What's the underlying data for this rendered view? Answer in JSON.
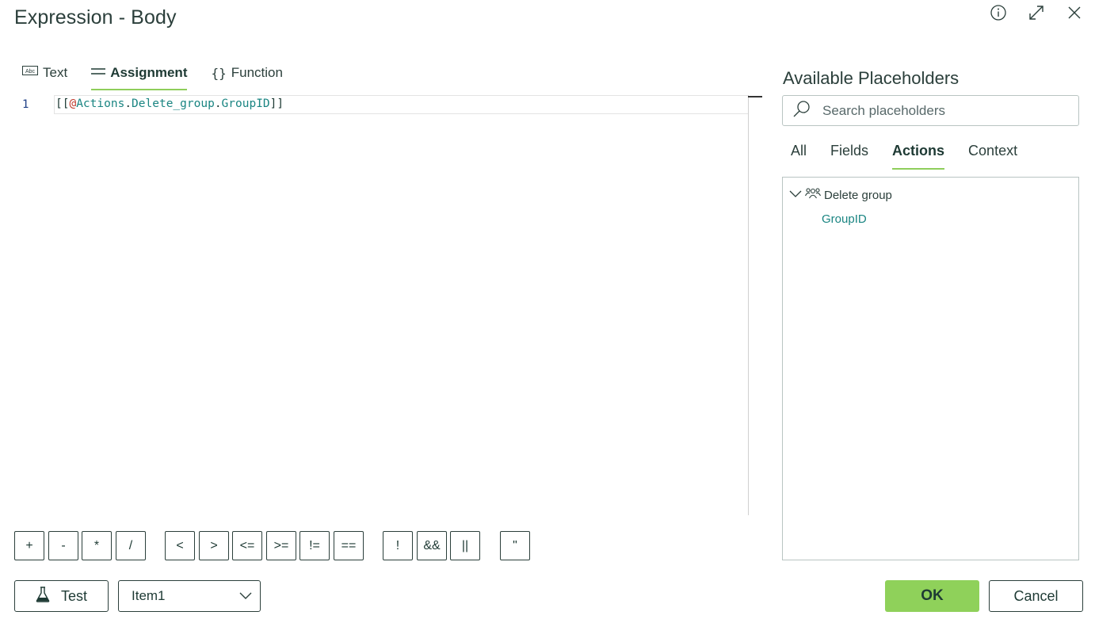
{
  "dialog": {
    "title": "Expression - Body",
    "window_icons": [
      "info-icon",
      "expand-icon",
      "close-icon"
    ]
  },
  "mode_tabs": [
    {
      "label": "Text",
      "icon": "text-abc-icon",
      "active": false
    },
    {
      "label": "Assignment",
      "icon": "assignment-lines-icon",
      "active": true
    },
    {
      "label": "Function",
      "icon": "braces-icon",
      "active": false
    }
  ],
  "editor": {
    "line_number": "1",
    "code_tokens": {
      "open": "[[",
      "at": "@",
      "part1": "Actions",
      "dot1": ".",
      "part2": "Delete_group",
      "dot2": ".",
      "part3": "GroupID",
      "close": "]]"
    }
  },
  "operators": [
    "+",
    "-",
    "*",
    "/",
    "<",
    ">",
    "<=",
    ">=",
    "!=",
    "==",
    "!",
    "&&",
    "||",
    "\""
  ],
  "footer": {
    "test_label": "Test",
    "item_select_value": "Item1",
    "ok_label": "OK",
    "cancel_label": "Cancel"
  },
  "placeholders": {
    "title": "Available Placeholders",
    "search_placeholder": "Search placeholders",
    "tabs": [
      {
        "label": "All",
        "active": false
      },
      {
        "label": "Fields",
        "active": false
      },
      {
        "label": "Actions",
        "active": true
      },
      {
        "label": "Context",
        "active": false
      }
    ],
    "tree": {
      "group_label": "Delete group",
      "group_icon": "group-people-icon",
      "leaf_label": "GroupID"
    }
  },
  "colors": {
    "accent": "#8fd15a",
    "text": "#1e3a34",
    "link": "#1a8582",
    "token_at": "#c0392b"
  }
}
